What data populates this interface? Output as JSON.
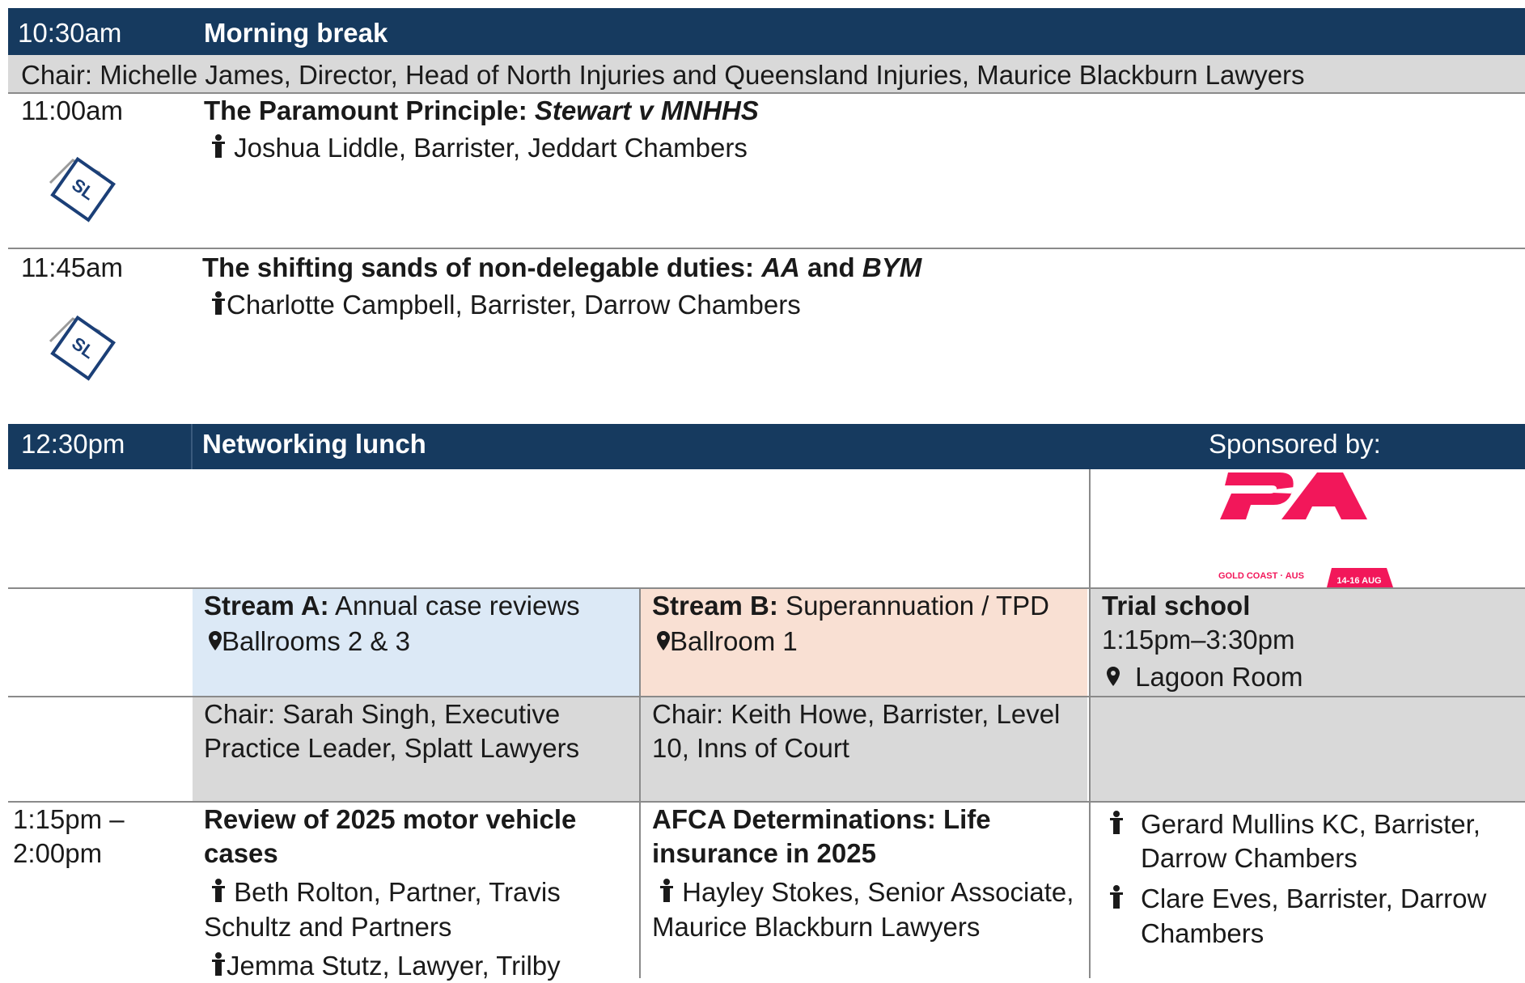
{
  "morning_break": {
    "time": "10:30am",
    "title": "Morning break",
    "chair": "Chair:  Michelle James, Director, Head of North Injuries and Queensland Injuries, Maurice Blackburn Lawyers"
  },
  "session_1": {
    "time": "11:00am",
    "title_prefix": "The Paramount Principle: ",
    "title_case": "Stewart v MNHHS",
    "speaker": "Joshua Liddle, Barrister, Jeddart Chambers",
    "badge": "SL"
  },
  "session_2": {
    "time": "11:45am",
    "title_prefix": "The shifting sands of non-delegable duties: ",
    "title_case_a": "AA",
    "title_and": " and ",
    "title_case_b": "BYM",
    "speaker": "Charlotte Campbell, Barrister, Darrow Chambers",
    "badge": "SL"
  },
  "lunch": {
    "time": "12:30pm",
    "title": "Networking lunch",
    "sponsored_by": "Sponsored by:",
    "sponsor_logo": {
      "caption": "GOLD COAST · AUS",
      "dates": "14-16 AUG",
      "color": "#f2175a"
    }
  },
  "streams": {
    "a": {
      "label": "Stream A:",
      "name": " Annual case reviews",
      "location": "Ballrooms 2 & 3",
      "chair": "Chair:  Sarah Singh, Executive Practice Leader, Splatt Lawyers"
    },
    "b": {
      "label": "Stream B:",
      "name": " Superannuation / TPD",
      "location": "Ballroom 1",
      "chair": "Chair:  Keith Howe, Barrister, Level 10, Inns of Court"
    },
    "c": {
      "label": "Trial school",
      "time": "1:15pm–3:30pm",
      "location": "Lagoon Room"
    }
  },
  "session_3": {
    "time": "1:15pm – 2:00pm",
    "a_title": "Review of 2025 motor vehicle cases",
    "a_speaker_1": "Beth Rolton, Partner, Travis Schultz and Partners",
    "a_speaker_2": "Jemma Stutz, Lawyer, Trilby",
    "b_title": "AFCA Determinations: Life insurance in 2025",
    "b_speaker_1": "Hayley Stokes, Senior Associate, Maurice Blackburn Lawyers",
    "c_speaker_1": "Gerard Mullins KC, Barrister, Darrow Chambers",
    "c_speaker_2": "Clare Eves, Barrister, Darrow Chambers"
  },
  "colors": {
    "header_navy": "#163a5f",
    "chair_grey": "#d9d9d9",
    "stream_a_blue": "#dce9f6",
    "stream_b_peach": "#f9e0d3"
  }
}
